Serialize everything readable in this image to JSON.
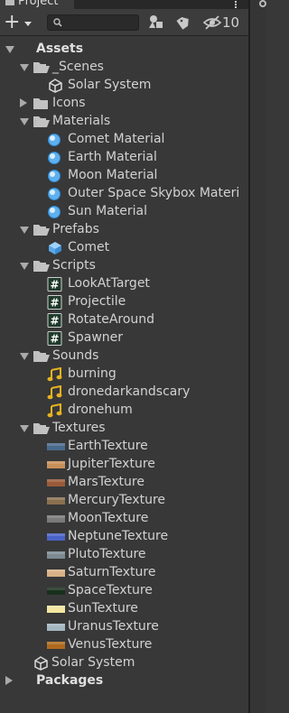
{
  "window": {
    "tab_title": "Project",
    "hidden_count": "10"
  },
  "search": {
    "placeholder": ""
  },
  "icons": {
    "add": "plus-icon",
    "search": "search-icon",
    "type_filter": "shapes-icon",
    "label_filter": "tag-icon",
    "hidden": "eye-slash-icon"
  },
  "colors": {
    "background": "#383838",
    "toolbar": "#3c3c3c",
    "accent": "#3a79bb"
  },
  "tree": [
    {
      "label": "Assets",
      "depth": 0,
      "state": "open",
      "icon": "none",
      "bold": true
    },
    {
      "label": "_Scenes",
      "depth": 1,
      "state": "open",
      "icon": "folder-open"
    },
    {
      "label": "Solar System",
      "depth": 2,
      "state": "leaf",
      "icon": "unity-scene"
    },
    {
      "label": "Icons",
      "depth": 1,
      "state": "closed",
      "icon": "folder"
    },
    {
      "label": "Materials",
      "depth": 1,
      "state": "open",
      "icon": "folder-open"
    },
    {
      "label": "Comet Material",
      "depth": 2,
      "state": "leaf",
      "icon": "material"
    },
    {
      "label": "Earth Material",
      "depth": 2,
      "state": "leaf",
      "icon": "material"
    },
    {
      "label": "Moon Material",
      "depth": 2,
      "state": "leaf",
      "icon": "material"
    },
    {
      "label": "Outer Space Skybox Materi",
      "depth": 2,
      "state": "leaf",
      "icon": "material"
    },
    {
      "label": "Sun Material",
      "depth": 2,
      "state": "leaf",
      "icon": "material"
    },
    {
      "label": "Prefabs",
      "depth": 1,
      "state": "open",
      "icon": "folder-open"
    },
    {
      "label": "Comet",
      "depth": 2,
      "state": "leaf",
      "icon": "prefab"
    },
    {
      "label": "Scripts",
      "depth": 1,
      "state": "open",
      "icon": "folder-open"
    },
    {
      "label": "LookAtTarget",
      "depth": 2,
      "state": "leaf",
      "icon": "script"
    },
    {
      "label": "Projectile",
      "depth": 2,
      "state": "leaf",
      "icon": "script"
    },
    {
      "label": "RotateAround",
      "depth": 2,
      "state": "leaf",
      "icon": "script"
    },
    {
      "label": "Spawner",
      "depth": 2,
      "state": "leaf",
      "icon": "script"
    },
    {
      "label": "Sounds",
      "depth": 1,
      "state": "open",
      "icon": "folder-open"
    },
    {
      "label": "burning",
      "depth": 2,
      "state": "leaf",
      "icon": "audio"
    },
    {
      "label": "dronedarkandscary",
      "depth": 2,
      "state": "leaf",
      "icon": "audio"
    },
    {
      "label": "dronehum",
      "depth": 2,
      "state": "leaf",
      "icon": "audio"
    },
    {
      "label": "Textures",
      "depth": 1,
      "state": "open",
      "icon": "folder-open"
    },
    {
      "label": "EarthTexture",
      "depth": 2,
      "state": "leaf",
      "icon": "texture",
      "swatch": "#4a6a8c"
    },
    {
      "label": "JupiterTexture",
      "depth": 2,
      "state": "leaf",
      "icon": "texture",
      "swatch": "#c8905a"
    },
    {
      "label": "MarsTexture",
      "depth": 2,
      "state": "leaf",
      "icon": "texture",
      "swatch": "#9a5a3a"
    },
    {
      "label": "MercuryTexture",
      "depth": 2,
      "state": "leaf",
      "icon": "texture",
      "swatch": "#8a7050"
    },
    {
      "label": "MoonTexture",
      "depth": 2,
      "state": "leaf",
      "icon": "texture",
      "swatch": "#7a7a7a"
    },
    {
      "label": "NeptuneTexture",
      "depth": 2,
      "state": "leaf",
      "icon": "texture",
      "swatch": "#4a62c8"
    },
    {
      "label": "PlutoTexture",
      "depth": 2,
      "state": "leaf",
      "icon": "texture",
      "swatch": "#7d8a92"
    },
    {
      "label": "SaturnTexture",
      "depth": 2,
      "state": "leaf",
      "icon": "texture",
      "swatch": "#d8b088"
    },
    {
      "label": "SpaceTexture",
      "depth": 2,
      "state": "leaf",
      "icon": "texture",
      "swatch": "#18301e"
    },
    {
      "label": "SunTexture",
      "depth": 2,
      "state": "leaf",
      "icon": "texture",
      "swatch": "#f2e6a0"
    },
    {
      "label": "UranusTexture",
      "depth": 2,
      "state": "leaf",
      "icon": "texture",
      "swatch": "#a4b6c0"
    },
    {
      "label": "VenusTexture",
      "depth": 2,
      "state": "leaf",
      "icon": "texture",
      "swatch": "#b06a1e"
    },
    {
      "label": "Solar System",
      "depth": 1,
      "state": "leaf",
      "icon": "unity-scene"
    },
    {
      "label": "Packages",
      "depth": 0,
      "state": "closed",
      "icon": "none",
      "bold": true
    }
  ]
}
